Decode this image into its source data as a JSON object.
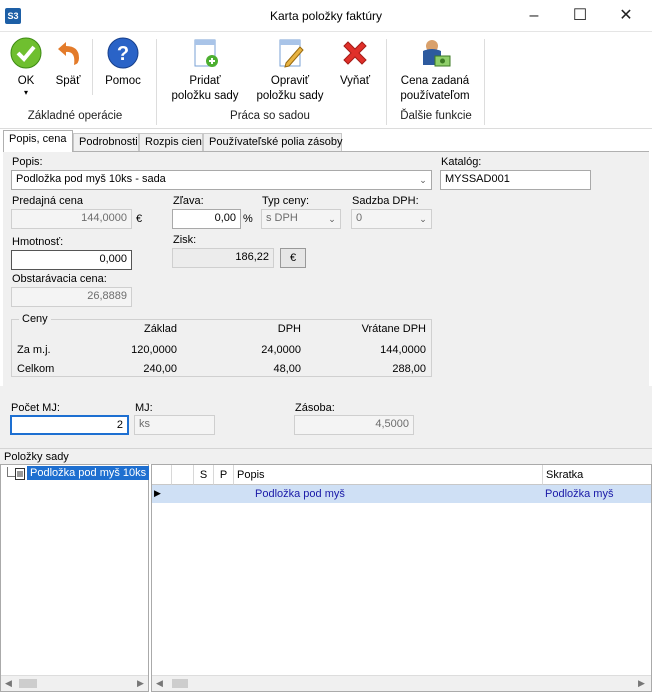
{
  "window": {
    "title": "Karta položky faktúry",
    "app_badge": "S3"
  },
  "ribbon": {
    "ok_label": "OK",
    "back_label": "Späť",
    "help_label": "Pomoc",
    "group1_label": "Základné operácie",
    "add_label": "Pridať\npoložku sady",
    "edit_label": "Opraviť\npoložku sady",
    "remove_label": "Vyňať",
    "group2_label": "Práca so sadou",
    "price_user_label": "Cena zadaná\npoužívateľom",
    "group3_label": "Ďalšie funkcie"
  },
  "tabs": [
    "Popis, cena",
    "Podrobnosti",
    "Rozpis cien",
    "Používateľské polia zásoby"
  ],
  "form": {
    "popis_label": "Popis:",
    "popis_value": "Podložka pod myš 10ks - sada",
    "katalog_label": "Katalóg:",
    "katalog_value": "MYSSAD001",
    "predajna_label": "Predajná cena",
    "predajna_value": "144,0000",
    "currency": "€",
    "zlava_label": "Zľava:",
    "zlava_value": "0,00",
    "percent": "%",
    "typ_label": "Typ ceny:",
    "typ_value": "s DPH",
    "sadzba_label": "Sadzba DPH:",
    "sadzba_value": "0",
    "hmotnost_label": "Hmotnosť:",
    "hmotnost_value": "0,000",
    "zisk_label": "Zisk:",
    "zisk_value": "186,22",
    "zisk_btn": "€",
    "obstar_label": "Obstarávacia cena:",
    "obstar_value": "26,8889"
  },
  "ceny": {
    "title": "Ceny",
    "headers": [
      "Základ",
      "DPH",
      "Vrátane DPH"
    ],
    "rows": [
      {
        "label": "Za m.j.",
        "zaklad": "120,0000",
        "dph": "24,0000",
        "vratane": "144,0000"
      },
      {
        "label": "Celkom",
        "zaklad": "240,00",
        "dph": "48,00",
        "vratane": "288,00"
      }
    ]
  },
  "lower": {
    "pocet_label": "Počet MJ:",
    "pocet_value": "2",
    "mj_label": "MJ:",
    "mj_value": "ks",
    "zasoba_label": "Zásoba:",
    "zasoba_value": "4,5000"
  },
  "sada": {
    "header": "Položky sady",
    "tree_item": "Podložka pod myš 10ks",
    "columns": [
      "S",
      "P",
      "Popis",
      "Skratka"
    ],
    "rows": [
      {
        "popis": "Podložka pod myš",
        "skratka": "Podložka myš"
      }
    ]
  }
}
